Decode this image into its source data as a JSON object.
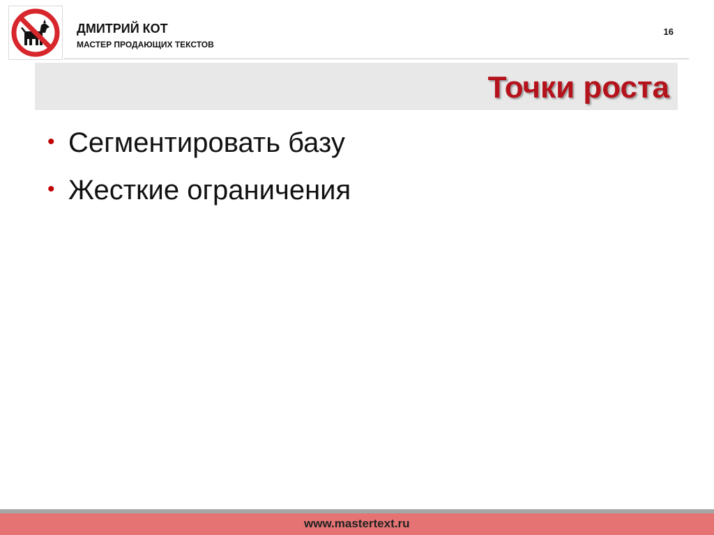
{
  "header": {
    "author_name": "ДМИТРИЙ КОТ",
    "author_tagline": "МАСТЕР ПРОДАЮЩИХ ТЕКСТОВ",
    "page_number": "16",
    "logo_icon": "no-dogs-sign-icon"
  },
  "slide": {
    "title": "Точки роста",
    "bullets": [
      {
        "text": "Сегментировать базу"
      },
      {
        "text": "Жесткие ограничения"
      }
    ]
  },
  "footer": {
    "url": "www.mastertext.ru"
  },
  "colors": {
    "accent_red": "#b5121b",
    "bullet_red": "#c00000",
    "footer_band": "#e57373",
    "title_band": "#e8e8e8"
  }
}
